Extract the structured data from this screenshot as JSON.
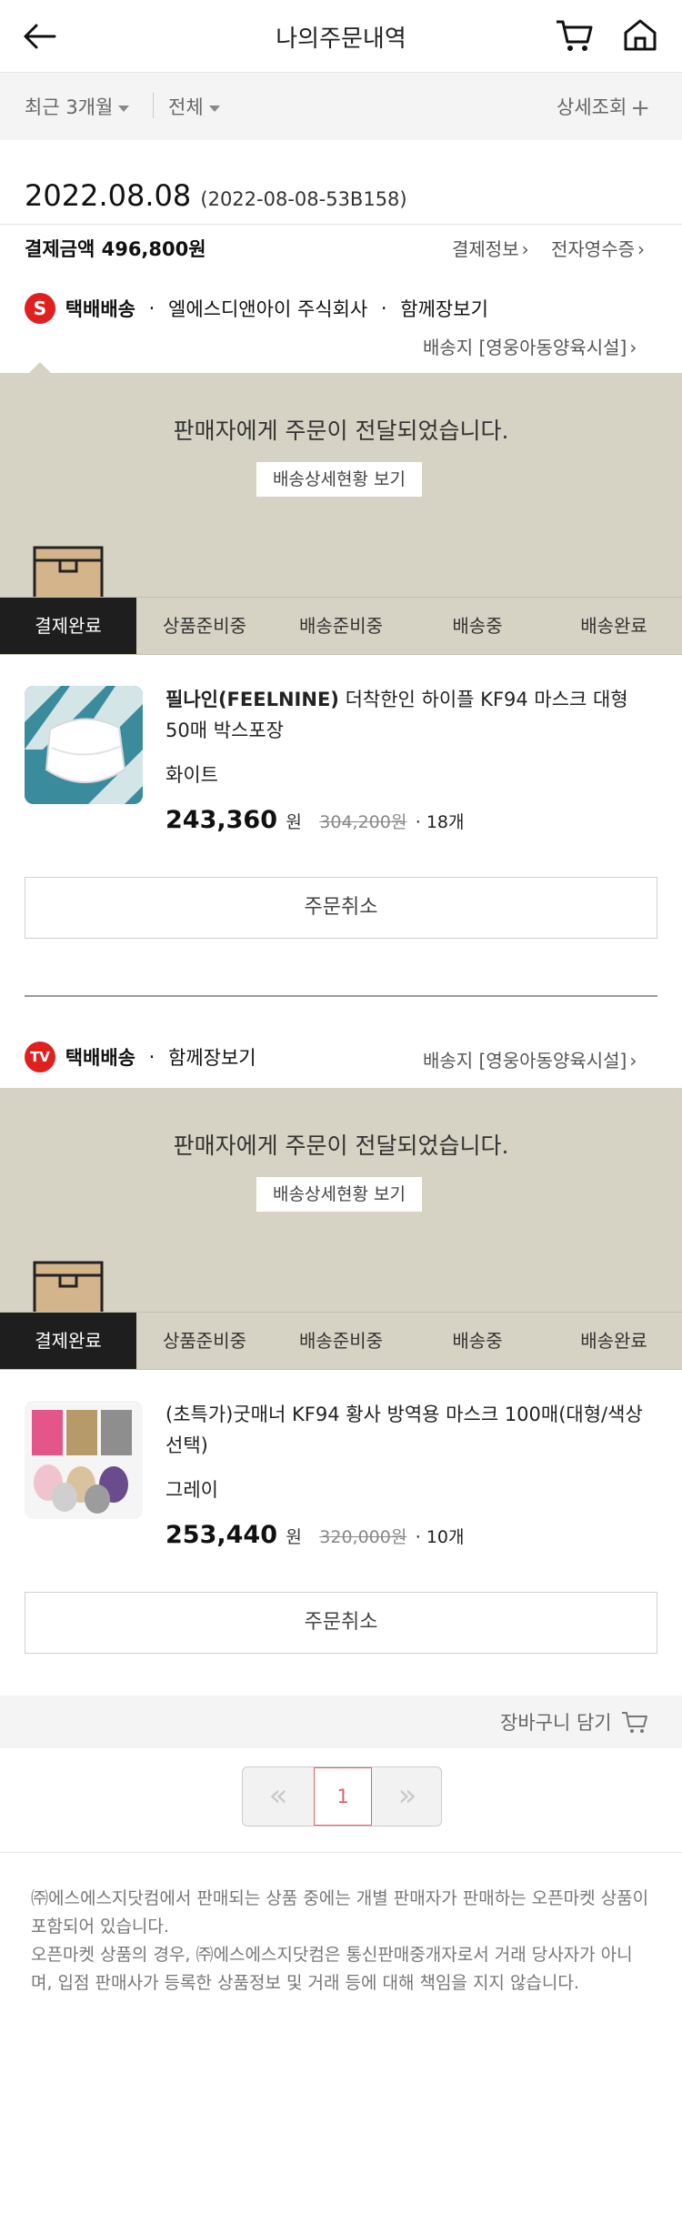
{
  "header": {
    "title": "나의주문내역",
    "back_icon": "arrow-left-icon",
    "cart_icon": "cart-icon",
    "home_icon": "home-icon"
  },
  "filters": {
    "period": "최근 3개월",
    "status": "전체",
    "detail": "상세조회"
  },
  "order": {
    "date": "2022.08.08",
    "order_no": "(2022-08-08-53B158)",
    "pay_label": "결제금액",
    "pay_amount": "496,800원",
    "pay_info": "결제정보",
    "receipt": "전자영수증"
  },
  "shipments": [
    {
      "badge": "S",
      "badge_color": "#e0201f",
      "type": "택배배송",
      "seller": "엘에스디앤아이 주식회사",
      "together": "함께장보기",
      "address": "배송지 [영웅아동양육시설]",
      "message": "판매자에게 주문이 전달되었습니다.",
      "tracking": "배송상세현황 보기",
      "steps": [
        "결제완료",
        "상품준비중",
        "배송준비중",
        "배송중",
        "배송완료"
      ],
      "product": {
        "brand": "필나인(FEELNINE)",
        "name": "더착한인 하이플 KF94 마스크 대형 50매 박스포장",
        "option": "화이트",
        "price": "243,360",
        "won": "원",
        "original": "304,200원",
        "qty": "18개"
      },
      "cancel": "주문취소"
    },
    {
      "badge": "TV",
      "badge_color": "#e0201f",
      "type": "택배배송",
      "together": "함께장보기",
      "address": "배송지 [영웅아동양육시설]",
      "message": "판매자에게 주문이 전달되었습니다.",
      "tracking": "배송상세현황 보기",
      "steps": [
        "결제완료",
        "상품준비중",
        "배송준비중",
        "배송중",
        "배송완료"
      ],
      "product": {
        "name": "(초특가)굿매너 KF94 황사 방역용 마스크 100매(대형/색상선택)",
        "option": "그레이",
        "price": "253,440",
        "won": "원",
        "original": "320,000원",
        "qty": "10개"
      },
      "cancel": "주문취소"
    }
  ],
  "cart": {
    "label": "장바구니 담기"
  },
  "pagination": {
    "current": "1",
    "prev": "«",
    "next": "»"
  },
  "notice": [
    "㈜에스에스지닷컴에서 판매되는 상품 중에는 개별 판매자가 판매하는 오픈마켓 상품이 포함되어 있습니다.",
    "오픈마켓 상품의 경우, ㈜에스에스지닷컴은 통신판매중개자로서 거래 당사자가 아니며, 입점 판매사가 등록한 상품정보 및 거래 등에 대해 책임을 지지 않습니다."
  ]
}
